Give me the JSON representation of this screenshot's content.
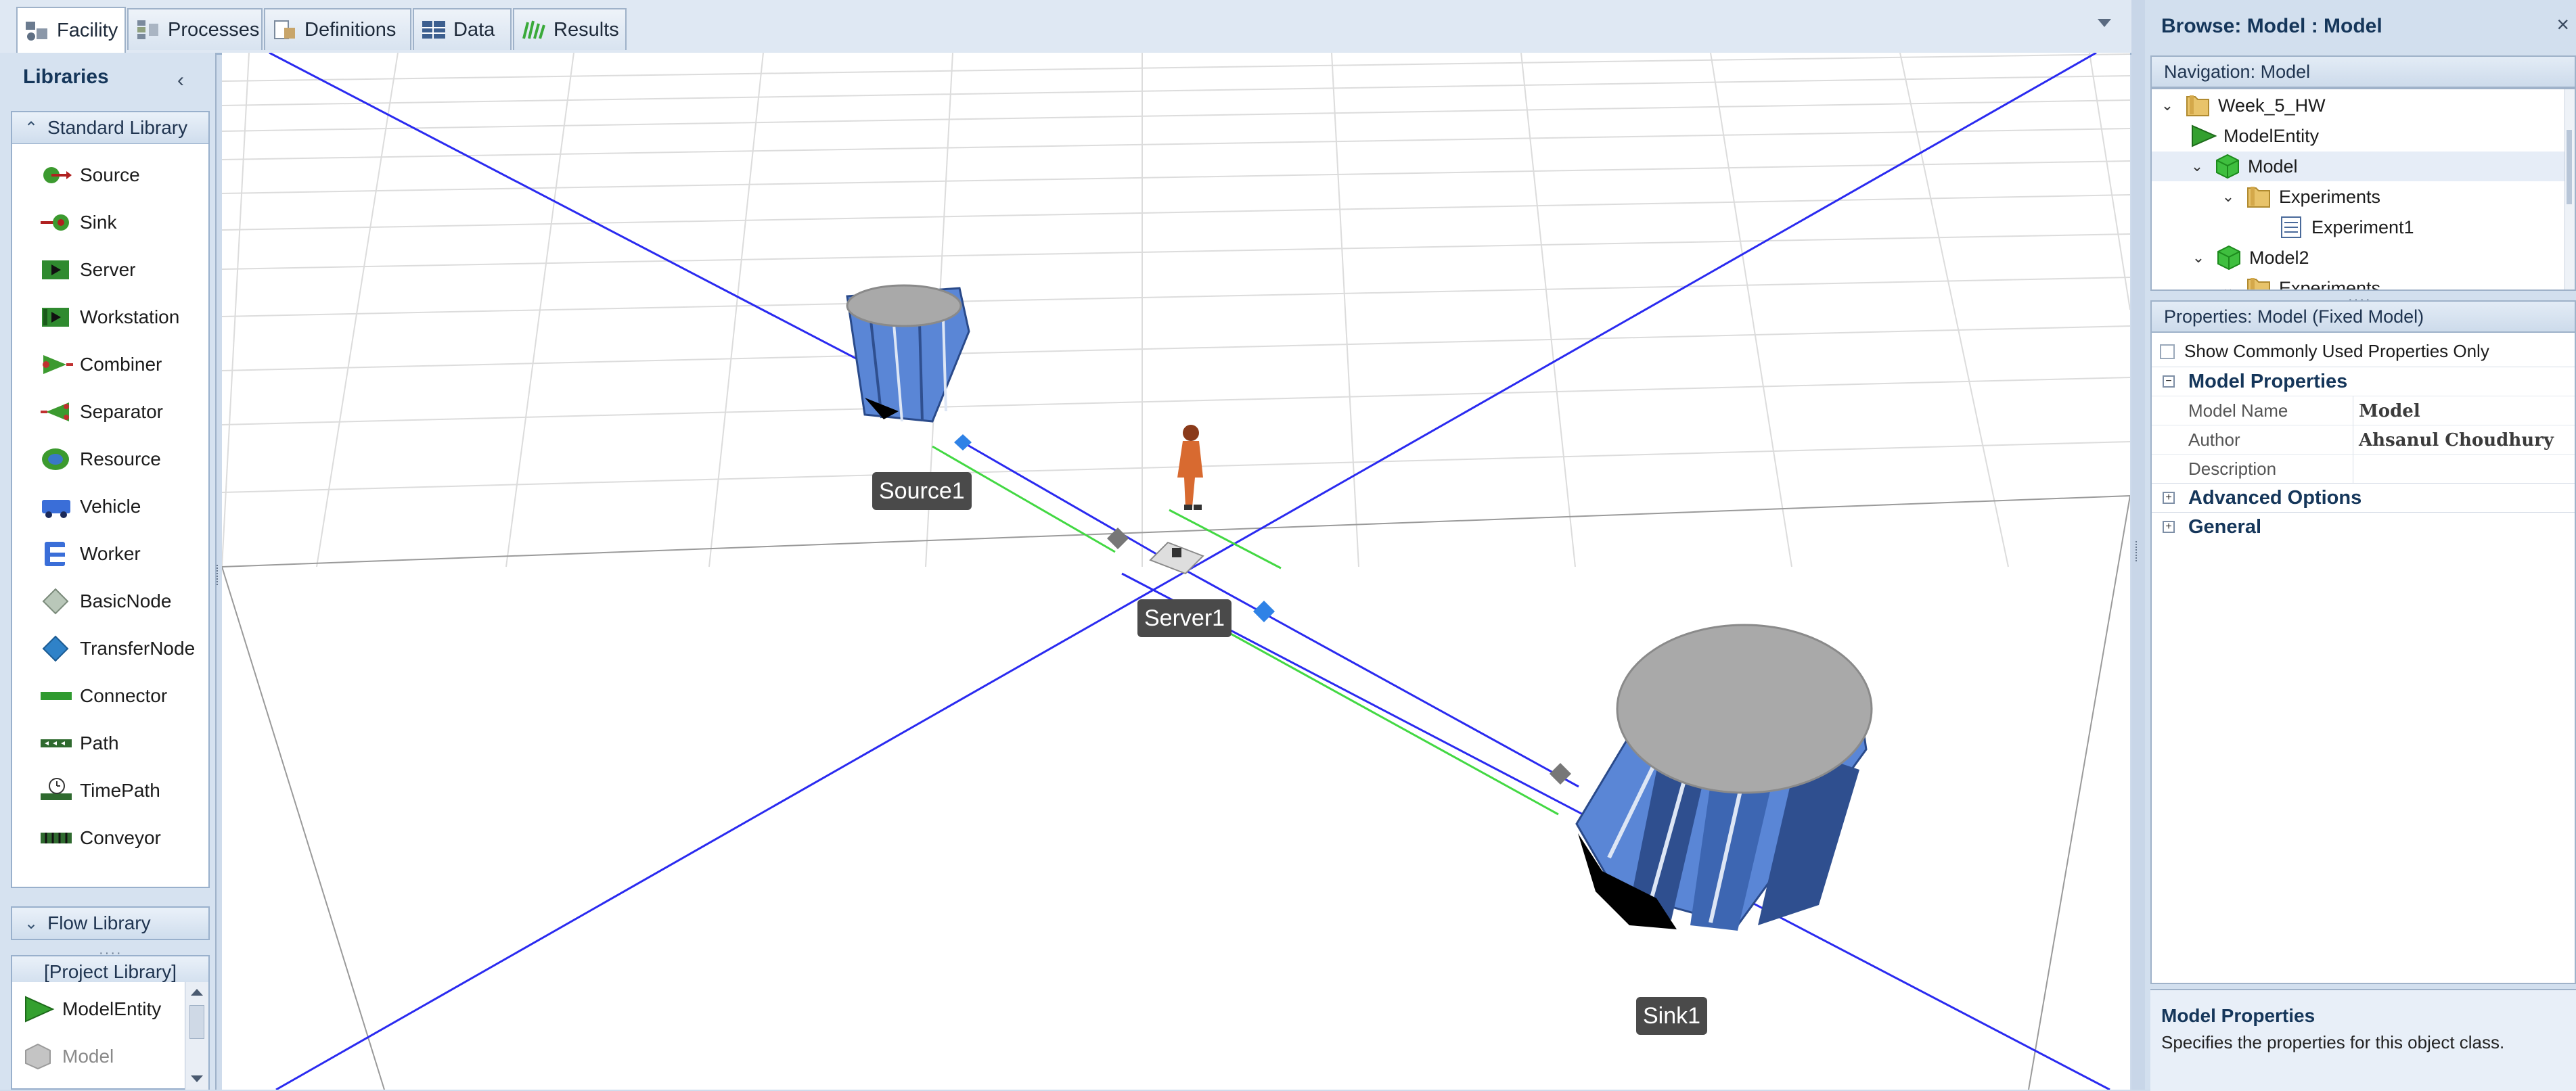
{
  "tabs": [
    {
      "label": "Facility",
      "icon": "facility-icon",
      "active": true
    },
    {
      "label": "Processes",
      "icon": "processes-icon",
      "active": false
    },
    {
      "label": "Definitions",
      "icon": "definitions-icon",
      "active": false
    },
    {
      "label": "Data",
      "icon": "data-table-icon",
      "active": false
    },
    {
      "label": "Results",
      "icon": "results-icon",
      "active": false
    }
  ],
  "libraries": {
    "title": "Libraries",
    "standard": {
      "header": "Standard Library",
      "items": [
        {
          "label": "Source",
          "icon": "source-icon"
        },
        {
          "label": "Sink",
          "icon": "sink-icon"
        },
        {
          "label": "Server",
          "icon": "server-icon"
        },
        {
          "label": "Workstation",
          "icon": "workstation-icon"
        },
        {
          "label": "Combiner",
          "icon": "combiner-icon"
        },
        {
          "label": "Separator",
          "icon": "separator-icon"
        },
        {
          "label": "Resource",
          "icon": "resource-icon"
        },
        {
          "label": "Vehicle",
          "icon": "vehicle-icon"
        },
        {
          "label": "Worker",
          "icon": "worker-icon"
        },
        {
          "label": "BasicNode",
          "icon": "basic-node-icon"
        },
        {
          "label": "TransferNode",
          "icon": "transfer-node-icon"
        },
        {
          "label": "Connector",
          "icon": "connector-icon"
        },
        {
          "label": "Path",
          "icon": "path-icon"
        },
        {
          "label": "TimePath",
          "icon": "time-path-icon"
        },
        {
          "label": "Conveyor",
          "icon": "conveyor-icon"
        }
      ]
    },
    "flow": {
      "header": "Flow Library"
    },
    "project": {
      "header": "[Project Library]",
      "items": [
        {
          "label": "ModelEntity",
          "icon": "model-entity-icon"
        },
        {
          "label": "Model",
          "icon": "model-icon"
        }
      ]
    }
  },
  "facility": {
    "objects": [
      {
        "label": "Source1"
      },
      {
        "label": "Server1"
      },
      {
        "label": "Sink1"
      }
    ]
  },
  "browse": {
    "title": "Browse: Model : Model",
    "navigation_header": "Navigation: Model",
    "tree": [
      {
        "label": "Week_5_HW",
        "icon": "folder-icon",
        "expanded": true
      },
      {
        "label": "ModelEntity",
        "icon": "entity-icon"
      },
      {
        "label": "Model",
        "icon": "model-cube-icon",
        "expanded": true,
        "selected": true
      },
      {
        "label": "Experiments",
        "icon": "folder-icon",
        "expanded": true
      },
      {
        "label": "Experiment1",
        "icon": "experiment-icon"
      },
      {
        "label": "Model2",
        "icon": "model-cube-icon",
        "expanded": true
      },
      {
        "label": "Experiments",
        "icon": "folder-icon",
        "expanded": true
      }
    ]
  },
  "properties": {
    "header": "Properties: Model (Fixed Model)",
    "show_common_label": "Show Commonly Used Properties Only",
    "category_model": "Model Properties",
    "rows": [
      {
        "key": "Model Name",
        "value": "Model"
      },
      {
        "key": "Author",
        "value": "Ahsanul Choudhury"
      },
      {
        "key": "Description",
        "value": ""
      }
    ],
    "category_advanced": "Advanced Options",
    "category_general": "General"
  },
  "help": {
    "title": "Model Properties",
    "text": "Specifies the properties for this object class."
  },
  "colors": {
    "accent": "#15365a",
    "grid_line": "#dedede",
    "path_blue": "#2a2af0",
    "path_green": "#43d843",
    "object_blue": "#5a86d6"
  }
}
